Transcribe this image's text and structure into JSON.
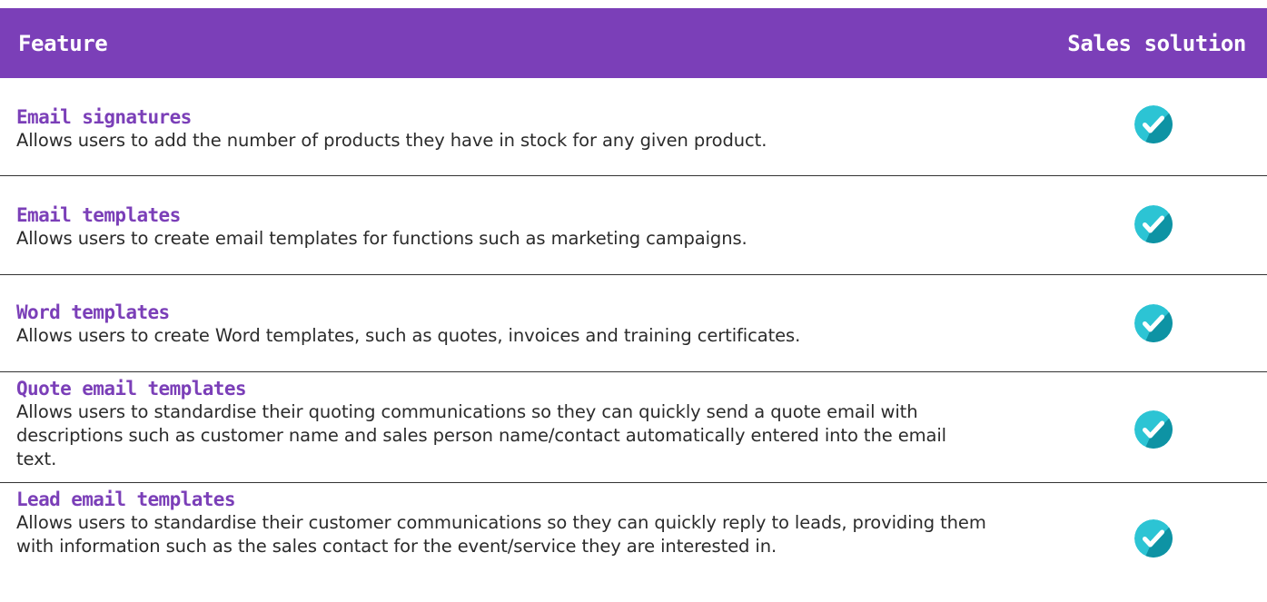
{
  "header": {
    "feature_label": "Feature",
    "solution_label": "Sales solution"
  },
  "colors": {
    "accent": "#7B3FB8",
    "check_light": "#2CC4D4",
    "check_dark": "#0E93A4"
  },
  "rows": [
    {
      "title": "Email signatures",
      "description": "Allows users to add the number of products they have in stock for any given product.",
      "included_icon": "check-circle-icon"
    },
    {
      "title": "Email templates",
      "description": "Allows users to create email templates for functions such as marketing campaigns.",
      "included_icon": "check-circle-icon"
    },
    {
      "title": "Word templates",
      "description": "Allows users to create Word templates, such as quotes, invoices and training certificates.",
      "included_icon": "check-circle-icon"
    },
    {
      "title": "Quote email templates",
      "description": "Allows users to standardise their quoting communications so they can quickly send a quote email with descriptions such as customer name and sales person name/contact automatically entered into the email text.",
      "included_icon": "check-circle-icon"
    },
    {
      "title": "Lead email templates",
      "description": "Allows users to standardise their customer communications so they can quickly reply to leads, providing them with information such as the sales contact for the event/service they are interested in.",
      "included_icon": "check-circle-icon"
    }
  ]
}
